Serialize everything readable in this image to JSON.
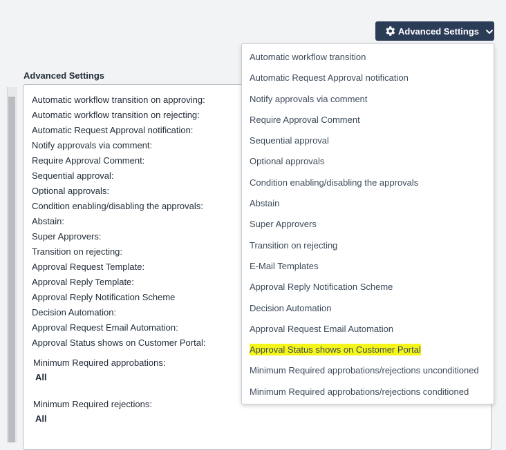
{
  "header": {
    "advanced_button_label": "Advanced Settings",
    "button_color": "#2b3c57"
  },
  "section": {
    "title": "Advanced Settings"
  },
  "settings_list": [
    "Automatic workflow transition on approving:",
    "Automatic workflow transition on rejecting:",
    "Automatic Request Approval notification:",
    "Notify approvals via comment:",
    "Require Approval Comment:",
    "Sequential approval:",
    "Optional approvals:",
    "Condition enabling/disabling the approvals:",
    "Abstain:",
    "Super Approvers:",
    "Transition on rejecting:",
    "Approval Request Template:",
    "Approval Reply Template:",
    "Approval Reply Notification Scheme",
    "Decision Automation:",
    "Approval Request Email Automation:",
    "Approval Status shows on Customer Portal:"
  ],
  "minimum_approvals": {
    "label": "Minimum Required approbations:",
    "value": "All"
  },
  "minimum_rejections": {
    "label": "Minimum Required rejections:",
    "value": "All"
  },
  "dropdown": {
    "items": [
      "Automatic workflow transition",
      "Automatic Request Approval notification",
      "Notify approvals via comment",
      "Require Approval Comment",
      "Sequential approval",
      "Optional approvals",
      "Condition enabling/disabling the approvals",
      "Abstain",
      "Super Approvers",
      "Transition on rejecting",
      "E-Mail Templates",
      "Approval Reply Notification Scheme",
      "Decision Automation",
      "Approval Request Email Automation",
      "Approval Status shows on Customer Portal",
      "Minimum Required approbations/rejections unconditioned",
      "Minimum Required approbations/rejections conditioned"
    ],
    "highlighted_item": "Approval Status shows on Customer Portal",
    "highlight_color": "#f5f51a"
  },
  "icons": {
    "button_icon": "gear-icon",
    "button_chevron": "chevron-down-icon"
  }
}
